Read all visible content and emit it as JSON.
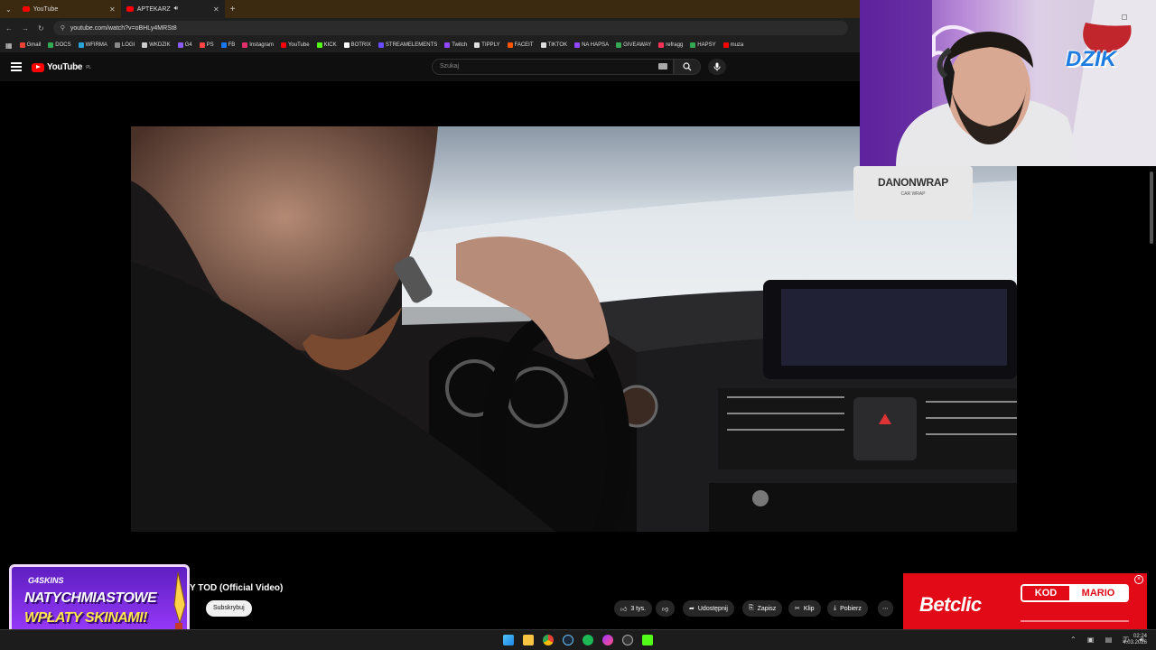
{
  "browser": {
    "tabs": [
      {
        "label": "YouTube",
        "active": false
      },
      {
        "label": "APTEKARZ",
        "active": true
      }
    ],
    "url": "youtube.com/watch?v=oBHLy4MRSt8",
    "bookmarks": [
      {
        "label": "Gmail",
        "color": "#ea4335"
      },
      {
        "label": "DOCS",
        "color": "#34a853"
      },
      {
        "label": "WFIRMA",
        "color": "#29a3d8"
      },
      {
        "label": "LOGI",
        "color": "#888888"
      },
      {
        "label": "WKDZIK",
        "color": "#cccccc"
      },
      {
        "label": "G4",
        "color": "#8b5cf6"
      },
      {
        "label": "PS",
        "color": "#ff4444"
      },
      {
        "label": "FB",
        "color": "#1877f2"
      },
      {
        "label": "Instagram",
        "color": "#e1306c"
      },
      {
        "label": "YouTube",
        "color": "#ff0000"
      },
      {
        "label": "KICK",
        "color": "#53fc18"
      },
      {
        "label": "BOTRIX",
        "color": "#ffffff"
      },
      {
        "label": "STREAMELEMENTS",
        "color": "#6a4cff"
      },
      {
        "label": "Twitch",
        "color": "#9146ff"
      },
      {
        "label": "TIPPLY",
        "color": "#dddddd"
      },
      {
        "label": "FACEIT",
        "color": "#ff5500"
      },
      {
        "label": "TIKTOK",
        "color": "#dddddd"
      },
      {
        "label": "NA HAPSA",
        "color": "#9146ff"
      },
      {
        "label": "GIVEAWAY",
        "color": "#34a853"
      },
      {
        "label": "refragg",
        "color": "#ff3355"
      },
      {
        "label": "HAPSY",
        "color": "#34a853"
      },
      {
        "label": "muza",
        "color": "#ff0000"
      }
    ]
  },
  "youtube": {
    "logo_text": "YouTube",
    "region": "PL",
    "search_placeholder": "Szukaj",
    "video_title": "Y TOD (Official Video)",
    "subscribe_label": "Subskrybuj",
    "actions": {
      "likes": "3 tys.",
      "share": "Udostępnij",
      "save": "Zapisz",
      "clip": "Klip",
      "download": "Pobierz"
    }
  },
  "video_scene": {
    "sticker_text": "DANONWRAP",
    "sticker_sub": "CAR WRAP"
  },
  "webcam": {
    "logo_text": "DZIK"
  },
  "overlays": {
    "promo_brand": "G4SKINS",
    "promo_line1": "NATYCHMIASTOWE",
    "promo_line2": "WPŁATY SKINAMI!",
    "betclic_logo": "Betclic",
    "betclic_kod": "KOD",
    "betclic_code": "MARIO"
  },
  "taskbar": {
    "time": "02:24",
    "date": "4.03.2026"
  }
}
